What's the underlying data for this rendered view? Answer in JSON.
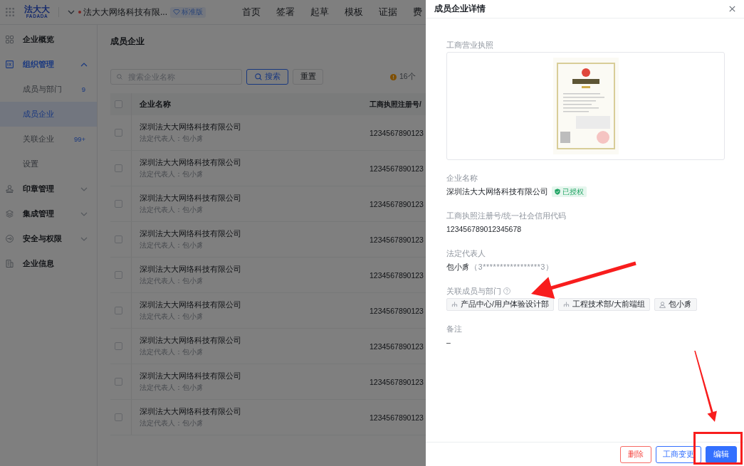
{
  "top_bar": {
    "logo": {
      "name": "法大大",
      "subtitle": "FADADA"
    },
    "company": {
      "name": "法大大网络科技有限...",
      "plan": "标准版"
    },
    "nav": [
      {
        "label": "首页",
        "selected": false
      },
      {
        "label": "签署",
        "selected": false
      },
      {
        "label": "起草",
        "selected": false
      },
      {
        "label": "模板",
        "selected": false
      },
      {
        "label": "证据",
        "selected": false
      },
      {
        "label": "费",
        "selected": false
      }
    ]
  },
  "sidebar": {
    "items": [
      {
        "label": "企业概览",
        "selected": false
      },
      {
        "label": "组织管理",
        "selected": false,
        "expanded": true,
        "children": [
          {
            "label": "成员与部门",
            "badge": "9",
            "selected": false
          },
          {
            "label": "成员企业",
            "selected": true
          },
          {
            "label": "关联企业",
            "badge": "99+",
            "selected": false
          },
          {
            "label": "设置",
            "selected": false
          }
        ]
      },
      {
        "label": "印章管理",
        "selected": false,
        "expanded": false
      },
      {
        "label": "集成管理",
        "selected": false,
        "expanded": false
      },
      {
        "label": "安全与权限",
        "selected": false,
        "expanded": false
      },
      {
        "label": "企业信息",
        "selected": false
      }
    ]
  },
  "page": {
    "title": "成员企业"
  },
  "toolbar": {
    "search": {
      "placeholder": "搜索企业名称"
    },
    "search_button": "搜索",
    "reset_button": "重置",
    "notice": "16个"
  },
  "table": {
    "select_all_checked": false,
    "columns": [
      "企业名称",
      "工商执照注册号/"
    ],
    "rows": [
      {
        "checked": false,
        "name": "深圳法大大网络科技有限公司",
        "representative": "法定代表人：包小豸",
        "registration": "1234567890123"
      },
      {
        "checked": false,
        "name": "深圳法大大网络科技有限公司",
        "representative": "法定代表人：包小豸",
        "registration": "1234567890123"
      },
      {
        "checked": false,
        "name": "深圳法大大网络科技有限公司",
        "representative": "法定代表人：包小豸",
        "registration": "1234567890123"
      },
      {
        "checked": false,
        "name": "深圳法大大网络科技有限公司",
        "representative": "法定代表人：包小豸",
        "registration": "1234567890123"
      },
      {
        "checked": false,
        "name": "深圳法大大网络科技有限公司",
        "representative": "法定代表人：包小豸",
        "registration": "1234567890123"
      },
      {
        "checked": false,
        "name": "深圳法大大网络科技有限公司",
        "representative": "法定代表人：包小豸",
        "registration": "1234567890123"
      },
      {
        "checked": false,
        "name": "深圳法大大网络科技有限公司",
        "representative": "法定代表人：包小豸",
        "registration": "1234567890123"
      },
      {
        "checked": false,
        "name": "深圳法大大网络科技有限公司",
        "representative": "法定代表人：包小豸",
        "registration": "1234567890123"
      },
      {
        "checked": false,
        "name": "深圳法大大网络科技有限公司",
        "representative": "法定代表人：包小豸",
        "registration": "1234567890123"
      }
    ]
  },
  "drawer": {
    "title": "成员企业详情",
    "fields": [
      {
        "kind": "image",
        "label": "工商营业执照"
      },
      {
        "kind": "text",
        "label": "企业名称",
        "value": "深圳法大大网络科技有限公司",
        "badge": "已授权"
      },
      {
        "kind": "text",
        "label": "工商执照注册号/统一社会信用代码",
        "value": "123456789012345678"
      },
      {
        "kind": "text",
        "label": "法定代表人",
        "value": "包小豸",
        "note": "（3*****************3）"
      },
      {
        "kind": "tags",
        "label": "关联成员与部门",
        "help": true,
        "tags": [
          {
            "kind": "department",
            "label": "产品中心/用户体验设计部"
          },
          {
            "kind": "department",
            "label": "工程技术部/大前端组"
          },
          {
            "kind": "member",
            "label": "包小豸"
          }
        ]
      },
      {
        "kind": "text",
        "label": "备注",
        "value": "–"
      }
    ],
    "buttons": [
      {
        "kind": "danger",
        "label": "删除"
      },
      {
        "kind": "outline",
        "label": "工商变更"
      },
      {
        "kind": "primary",
        "label": "编辑"
      }
    ]
  },
  "annotations": [
    {
      "kind": "arrow"
    },
    {
      "kind": "arrow"
    },
    {
      "kind": "frame"
    }
  ]
}
